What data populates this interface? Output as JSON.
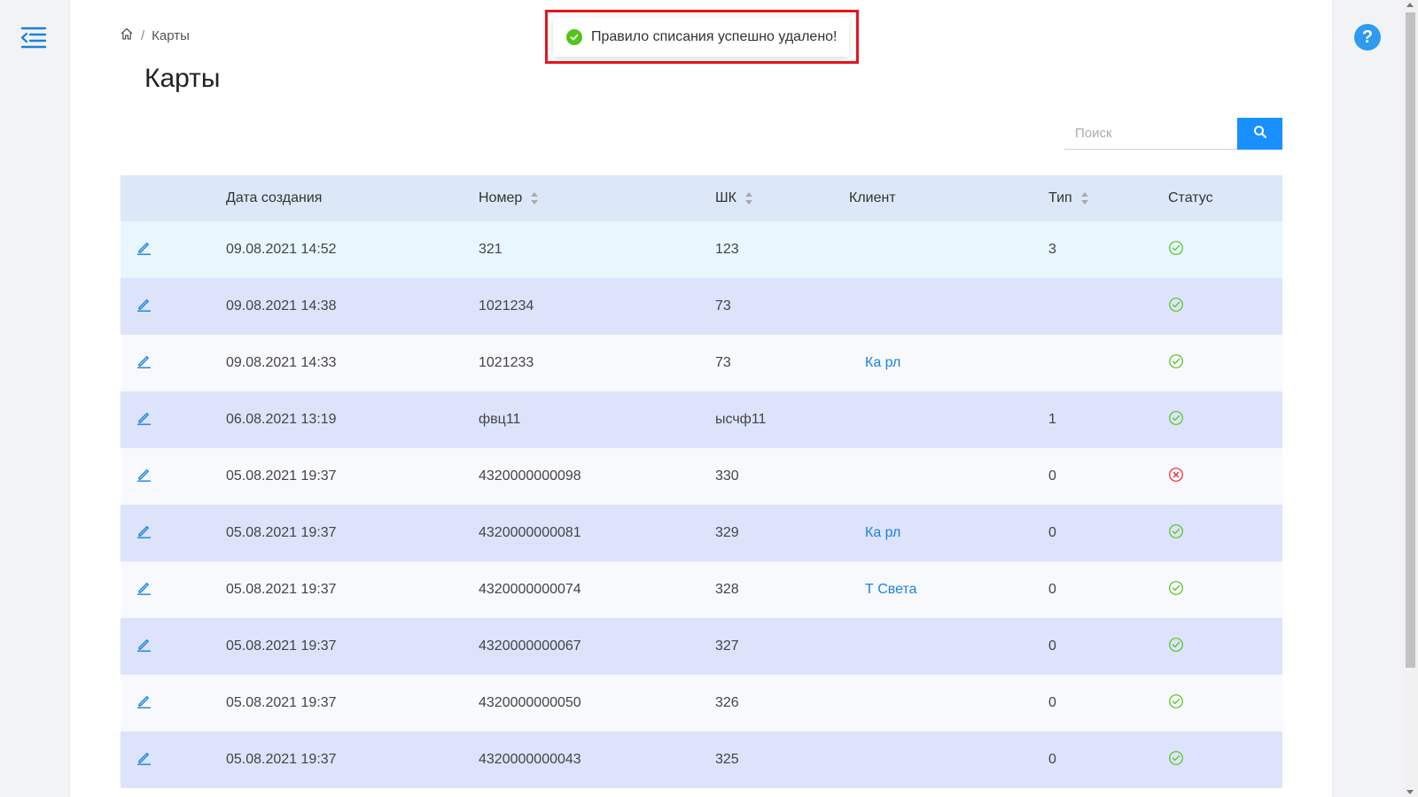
{
  "breadcrumb": {
    "current": "Карты"
  },
  "page": {
    "title": "Карты"
  },
  "toast": {
    "message": "Правило списания успешно удалено!"
  },
  "help": {
    "label": "?"
  },
  "search": {
    "placeholder": "Поиск"
  },
  "table": {
    "headers": {
      "date": "Дата создания",
      "number": "Номер",
      "barcode": "ШК",
      "client": "Клиент",
      "type": "Тип",
      "status": "Статус"
    },
    "rows": [
      {
        "date": "09.08.2021 14:52",
        "number": "321",
        "barcode": "123",
        "client": "",
        "type": "3",
        "status": "active"
      },
      {
        "date": "09.08.2021 14:38",
        "number": "1021234",
        "barcode": "73",
        "client": "",
        "type": "",
        "status": "active"
      },
      {
        "date": "09.08.2021 14:33",
        "number": "1021233",
        "barcode": "73",
        "client": "Ка рл",
        "type": "",
        "status": "active"
      },
      {
        "date": "06.08.2021 13:19",
        "number": "фвц11",
        "barcode": "ысчф11",
        "client": "",
        "type": "1",
        "status": "active"
      },
      {
        "date": "05.08.2021 19:37",
        "number": "4320000000098",
        "barcode": "330",
        "client": "",
        "type": "0",
        "status": "inactive"
      },
      {
        "date": "05.08.2021 19:37",
        "number": "4320000000081",
        "barcode": "329",
        "client": "Ка рл",
        "type": "0",
        "status": "active"
      },
      {
        "date": "05.08.2021 19:37",
        "number": "4320000000074",
        "barcode": "328",
        "client": "Т Света",
        "type": "0",
        "status": "active"
      },
      {
        "date": "05.08.2021 19:37",
        "number": "4320000000067",
        "barcode": "327",
        "client": "",
        "type": "0",
        "status": "active"
      },
      {
        "date": "05.08.2021 19:37",
        "number": "4320000000050",
        "barcode": "326",
        "client": "",
        "type": "0",
        "status": "active"
      },
      {
        "date": "05.08.2021 19:37",
        "number": "4320000000043",
        "barcode": "325",
        "client": "",
        "type": "0",
        "status": "active"
      }
    ]
  },
  "colors": {
    "accent": "#1890ff",
    "active": "#52c41a",
    "inactive": "#f5222d",
    "link": "#1a83e0",
    "highlight": "#e8141c"
  }
}
